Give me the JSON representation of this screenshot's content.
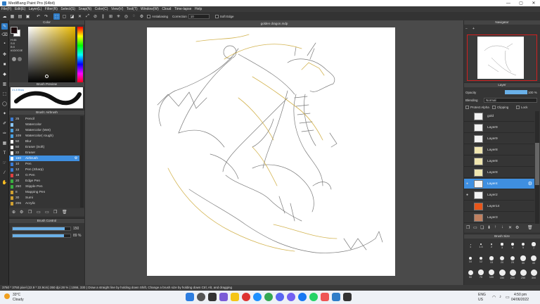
{
  "window": {
    "title": "MediBang Paint Pro (64bit)",
    "minimize": "—",
    "maximize": "▢",
    "close": "✕"
  },
  "menu": [
    "File(F)",
    "Edit(E)",
    "Layer(L)",
    "Filter(R)",
    "Select(S)",
    "Snap(N)",
    "Color(C)",
    "View(V)",
    "Tool(T)",
    "Window(W)",
    "Cloud",
    "Time-lapse",
    "Help"
  ],
  "toolbar": {
    "antialiasing": "Antialiasing",
    "correction_label": "Correction",
    "correction_value": "10",
    "soft_edge": "Soft Edge"
  },
  "color_panel": {
    "title": "Color",
    "hsv": [
      "H:46",
      "S:0",
      "B:0"
    ],
    "hex": "#1D0C0E",
    "accent_fg": "#1d0c0e",
    "accent_bg": "#ffffff"
  },
  "brush_preview": {
    "title": "Brush Preview",
    "size_text": "21.8 Brus"
  },
  "brush_list": {
    "title": "Brush: Airbrush",
    "items": [
      {
        "size": "25",
        "name": "Pencil",
        "color": "#3a7bd5"
      },
      {
        "size": "",
        "name": "Watercolor",
        "color": "#8cc8ff"
      },
      {
        "size": "33",
        "name": "Watercolor (Wet)",
        "color": "#4aa0e0"
      },
      {
        "size": "109",
        "name": "Watercolor( rough)",
        "color": "#4aa0e0"
      },
      {
        "size": "50",
        "name": "Blur",
        "color": "#ffffff"
      },
      {
        "size": "50",
        "name": "Eraser (Soft)",
        "color": "#ffffff"
      },
      {
        "size": "22",
        "name": "Eraser",
        "color": "#ffffff"
      },
      {
        "size": "150",
        "name": "Airbrush",
        "color": "#ffffff"
      },
      {
        "size": "10",
        "name": "Pen",
        "color": "#3a7bd5"
      },
      {
        "size": "12",
        "name": "Pen (Sharp)",
        "color": "#3a7bd5"
      },
      {
        "size": "18",
        "name": "G Pen",
        "color": "#e04040"
      },
      {
        "size": "20",
        "name": "Edge Pen",
        "color": "#3ab040"
      },
      {
        "size": "250",
        "name": "Stipple Pen",
        "color": "#3ab040"
      },
      {
        "size": "8",
        "name": "Mapping Pen",
        "color": "#d0a030"
      },
      {
        "size": "30",
        "name": "Sumi",
        "color": "#d0a030"
      },
      {
        "size": "206",
        "name": "Acrylic",
        "color": "#d0a030"
      }
    ]
  },
  "brush_control": {
    "title": "Brush Control",
    "size": "150",
    "opacity": "89 %",
    "size_fraction": 0.9,
    "opacity_fraction": 0.89
  },
  "canvas": {
    "tab": "golden dragon.mdp"
  },
  "navigator": {
    "title": "Navigator"
  },
  "layer_panel": {
    "title": "Layer",
    "opacity_label": "Opacity",
    "opacity_value": "100 %",
    "blending_label": "Blending",
    "blending_value": "Normal",
    "protect_alpha": "Protect Alpha",
    "clipping": "Clipping",
    "lock": "Lock",
    "layers": [
      {
        "name": "gold",
        "visible": false,
        "selected": false,
        "thumb": "#f4f4f4"
      },
      {
        "name": "Layer9",
        "visible": false,
        "selected": false,
        "thumb": "#f4f4f4"
      },
      {
        "name": "Layer9",
        "visible": false,
        "selected": false,
        "thumb": "#f4f4f4"
      },
      {
        "name": "Layer8",
        "visible": false,
        "selected": false,
        "thumb": "#f0e6b0"
      },
      {
        "name": "Layer8",
        "visible": false,
        "selected": false,
        "thumb": "#f0e6b0"
      },
      {
        "name": "Layer8",
        "visible": false,
        "selected": false,
        "thumb": "#f0e6b0"
      },
      {
        "name": "Layer4",
        "visible": true,
        "selected": true,
        "thumb": "#f4f4f4"
      },
      {
        "name": "Layer2",
        "visible": true,
        "selected": false,
        "thumb": "#f4f4f4"
      },
      {
        "name": "Layer14",
        "visible": false,
        "selected": false,
        "thumb": "#e8561a"
      },
      {
        "name": "Layer3",
        "visible": false,
        "selected": false,
        "thumb": "#c08060"
      }
    ]
  },
  "brush_size_panel": {
    "title": "Brush Size",
    "sizes": [
      "1",
      "1.5",
      "2",
      "3",
      "4",
      "5",
      "7",
      "10",
      "12",
      "15",
      "20",
      "25",
      "30",
      "40",
      "50",
      "70",
      "100",
      "150",
      "200",
      "250",
      "300"
    ]
  },
  "status": {
    "text": "3750 * 3750 pixel   (22.9 * 22.9cm)   350 dpi   28 %   ( 1066, 330 )   Draw a straight line by holding down Shift, Change a brush size by holding down Ctrl, Alt, and dragging"
  },
  "taskbar": {
    "weather_temp": "33°C",
    "weather_desc": "Cloudy",
    "lang1": "ENG",
    "lang2": "US",
    "time": "4:50 pm",
    "date": "04/06/2022"
  }
}
